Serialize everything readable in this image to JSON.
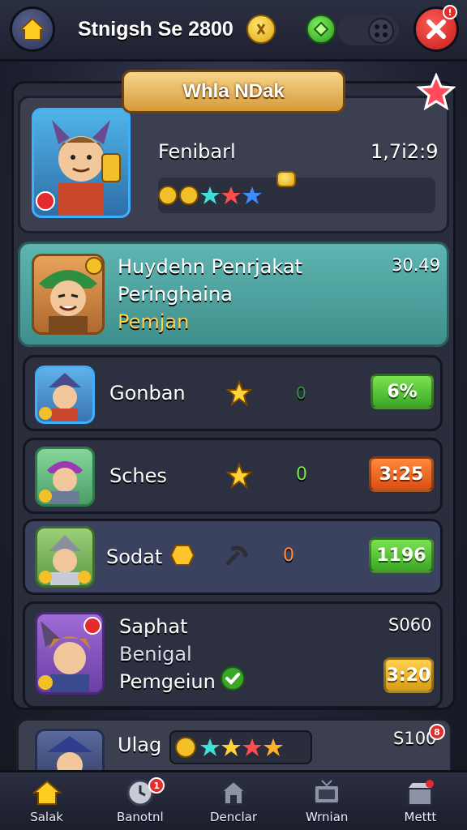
{
  "topbar": {
    "title": "Stnigsh Se 2800",
    "icons": [
      "home-icon",
      "gold-coin-icon",
      "green-gem-icon",
      "menu-dots-icon",
      "close-icon"
    ]
  },
  "banner": {
    "title": "Whla NDak"
  },
  "header": {
    "name": "Fenibarl",
    "score": "1,7i2:9"
  },
  "highlight": {
    "line1": "Huydehn Penrjakat",
    "line2": "Peringhaina",
    "line3": "Pemjan",
    "value": "30.49"
  },
  "rows": [
    {
      "name": "Gonban",
      "mid": "0",
      "value": "6%",
      "color": "#3aa826"
    },
    {
      "name": "Sches",
      "mid": "0",
      "value": "3:25",
      "color": "#db4d12"
    },
    {
      "name": "Sodat",
      "mid": "0",
      "value": "1196",
      "color": "#3aa826"
    }
  ],
  "row4": {
    "line1": "Saphat",
    "line2": "Benigal",
    "line3": "Pemgeiun",
    "value_top": "S060",
    "value": "3:20"
  },
  "bottom_card": {
    "name": "Ulag",
    "value": "S100",
    "badge": "8"
  },
  "nav": [
    {
      "label": "Salak",
      "icon": "home-icon"
    },
    {
      "label": "Banotnl",
      "icon": "clock-icon",
      "badge": "1"
    },
    {
      "label": "Denclar",
      "icon": "house-icon"
    },
    {
      "label": "Wrnian",
      "icon": "tv-icon"
    },
    {
      "label": "Mettt",
      "icon": "shop-icon"
    }
  ]
}
